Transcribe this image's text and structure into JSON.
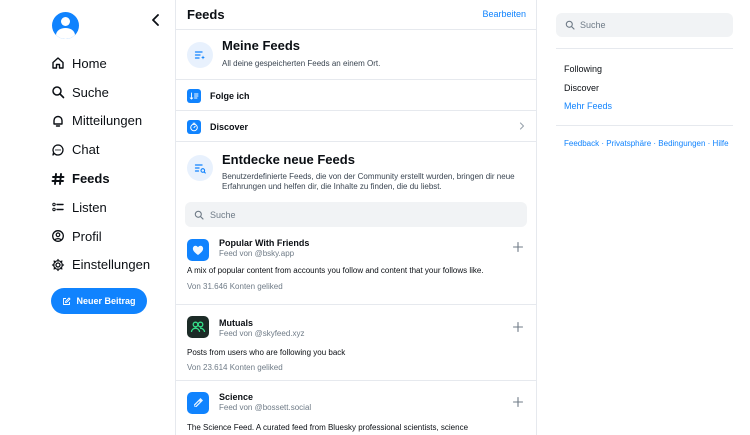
{
  "sidebar": {
    "items": [
      {
        "label": "Home",
        "icon": "home-icon"
      },
      {
        "label": "Suche",
        "icon": "search-icon"
      },
      {
        "label": "Mitteilungen",
        "icon": "bell-icon"
      },
      {
        "label": "Chat",
        "icon": "chat-icon"
      },
      {
        "label": "Feeds",
        "icon": "hash-icon",
        "active": true
      },
      {
        "label": "Listen",
        "icon": "list-icon"
      },
      {
        "label": "Profil",
        "icon": "profile-icon"
      },
      {
        "label": "Einstellungen",
        "icon": "gear-icon"
      }
    ],
    "new_post_label": "Neuer Beitrag"
  },
  "header": {
    "title": "Feeds",
    "edit_label": "Bearbeiten"
  },
  "my_feeds": {
    "title": "Meine Feeds",
    "subtitle": "All deine gespeicherten Feeds an einem Ort."
  },
  "pinned": [
    {
      "label": "Folge ich",
      "icon": "following-icon"
    },
    {
      "label": "Discover",
      "icon": "discover-icon"
    }
  ],
  "discover": {
    "title": "Entdecke neue Feeds",
    "subtitle": "Benutzerdefinierte Feeds, die von der Community erstellt wurden, bringen dir neue Erfahrungen und helfen dir, die Inhalte zu finden, die du liebst."
  },
  "search": {
    "placeholder": "Suche"
  },
  "feeds": [
    {
      "name": "Popular With Friends",
      "by": "Feed von @bsky.app",
      "description": "A mix of popular content from accounts you follow and content that your follows like.",
      "likes": "Von 31.646 Konten geliked",
      "icon_color": "#1083fe"
    },
    {
      "name": "Mutuals",
      "by": "Feed von @skyfeed.xyz",
      "description": "Posts from users who are following you back",
      "likes": "Von 23.614 Konten geliked",
      "icon_color": "#1c2b27"
    },
    {
      "name": "Science",
      "by": "Feed von @bossett.social",
      "description": "The Science Feed. A curated feed from Bluesky professional scientists,  science",
      "icon_color": "#1083fe"
    }
  ],
  "right": {
    "search_placeholder": "Suche",
    "links": [
      "Following",
      "Discover"
    ],
    "more_feeds": "Mehr Feeds",
    "footer": {
      "feedback": "Feedback",
      "privacy": "Privatsphäre",
      "terms": "Bedingungen",
      "help": "Hilfe",
      "separator": " · "
    }
  },
  "colors": {
    "accent": "#1083fe",
    "border": "#e6e9ee",
    "muted": "#6f7b87"
  }
}
